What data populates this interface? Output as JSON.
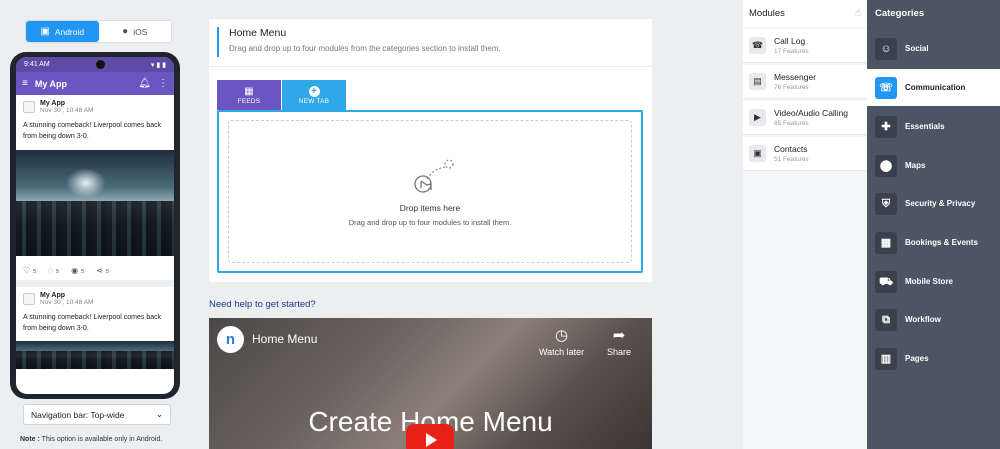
{
  "os_toggle": {
    "android": "Android",
    "ios": "iOS"
  },
  "phone": {
    "time": "9:41 AM",
    "app_title": "My App",
    "posts": [
      {
        "name": "My App",
        "date": "Nov 30 , 10:48 AM",
        "text": "A stunning comeback! Liverpool comes back from being down 3-0."
      },
      {
        "name": "My App",
        "date": "Nov 30 , 10:48 AM",
        "text": "A stunning comeback! Liverpool comes back from being down 3-0."
      }
    ],
    "counts": {
      "likes": "5",
      "comments": "5",
      "views": "5",
      "shares": "5"
    }
  },
  "nav_select": {
    "value": "Navigation bar: Top-wide"
  },
  "note": {
    "label": "Note :",
    "text": "This option is available only in Android."
  },
  "home_menu": {
    "title": "Home Menu",
    "subtitle": "Drag and drop up to four modules from the categories section to install them.",
    "tabs": {
      "feeds": "Feeds",
      "new_tab": "New Tab"
    },
    "drop_title": "Drop items here",
    "drop_sub": "Drag and drop up to four modules to install them."
  },
  "help": {
    "link": "Need help to get started?"
  },
  "video": {
    "title": "Home Menu",
    "watch_later": "Watch later",
    "share": "Share",
    "big_title": "Create Home Menu"
  },
  "modules": {
    "title": "Modules",
    "items": [
      {
        "name": "Call Log",
        "sub": "17 Features"
      },
      {
        "name": "Messenger",
        "sub": "76 Features"
      },
      {
        "name": "Video/Audio Calling",
        "sub": "85 Features"
      },
      {
        "name": "Contacts",
        "sub": "51 Features"
      }
    ]
  },
  "categories": {
    "title": "Categories",
    "items": [
      {
        "label": "Social"
      },
      {
        "label": "Communication"
      },
      {
        "label": "Essentials"
      },
      {
        "label": "Maps"
      },
      {
        "label": "Security & Privacy"
      },
      {
        "label": "Bookings & Events"
      },
      {
        "label": "Mobile Store"
      },
      {
        "label": "Workflow"
      },
      {
        "label": "Pages"
      }
    ]
  },
  "colors": {
    "accent": "#2196f3",
    "brand_purple": "#6a55c1",
    "sidebar": "#4b5563"
  }
}
